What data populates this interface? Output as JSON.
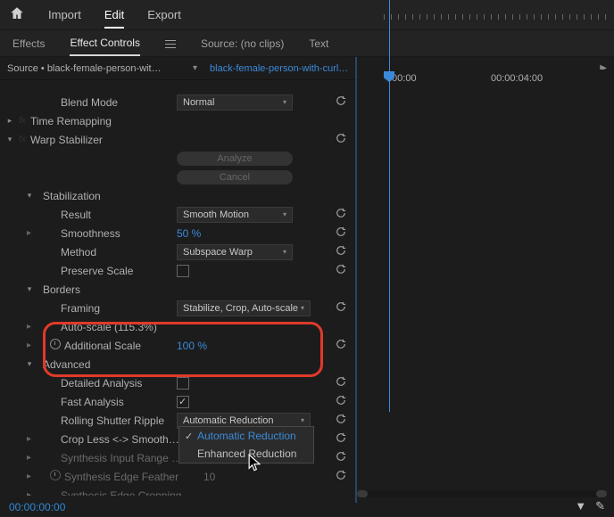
{
  "top_nav": {
    "import": "Import",
    "edit": "Edit",
    "export": "Export"
  },
  "sub_nav": {
    "effects": "Effects",
    "effect_controls": "Effect Controls",
    "source": "Source: (no clips)",
    "text": "Text"
  },
  "source": {
    "label": "Source • black-female-person-wit…",
    "clip": "black-female-person-with-curl…"
  },
  "timeline": {
    "t0": ":00:00",
    "t1": "00:00:04:00"
  },
  "panel": {
    "blend_mode": {
      "label": "Blend Mode",
      "value": "Normal"
    },
    "time_remapping": "Time Remapping",
    "warp": "Warp Stabilizer",
    "analyze": "Analyze",
    "cancel": "Cancel",
    "stabilization": "Stabilization",
    "result": {
      "label": "Result",
      "value": "Smooth Motion"
    },
    "smoothness": {
      "label": "Smoothness",
      "value": "50 %"
    },
    "method": {
      "label": "Method",
      "value": "Subspace Warp"
    },
    "preserve_scale": "Preserve Scale",
    "borders": "Borders",
    "framing": {
      "label": "Framing",
      "value": "Stabilize, Crop, Auto-scale"
    },
    "autoscale": "Auto-scale (115.3%)",
    "additional_scale": {
      "label": "Additional Scale",
      "value": "100 %"
    },
    "advanced": "Advanced",
    "detailed": "Detailed Analysis",
    "fast": "Fast Analysis",
    "rsr": {
      "label": "Rolling Shutter Ripple",
      "value": "Automatic Reduction"
    },
    "crop_less": "Crop Less <-> Smooth…",
    "synth_range": "Synthesis Input Range …",
    "synth_feather": {
      "label": "Synthesis Edge Feather",
      "value": "10"
    },
    "synth_crop": "Synthesis Edge Cropping"
  },
  "dropdown": {
    "opt1": "Automatic Reduction",
    "opt2": "Enhanced Reduction"
  },
  "timecode": "00:00:00:00"
}
